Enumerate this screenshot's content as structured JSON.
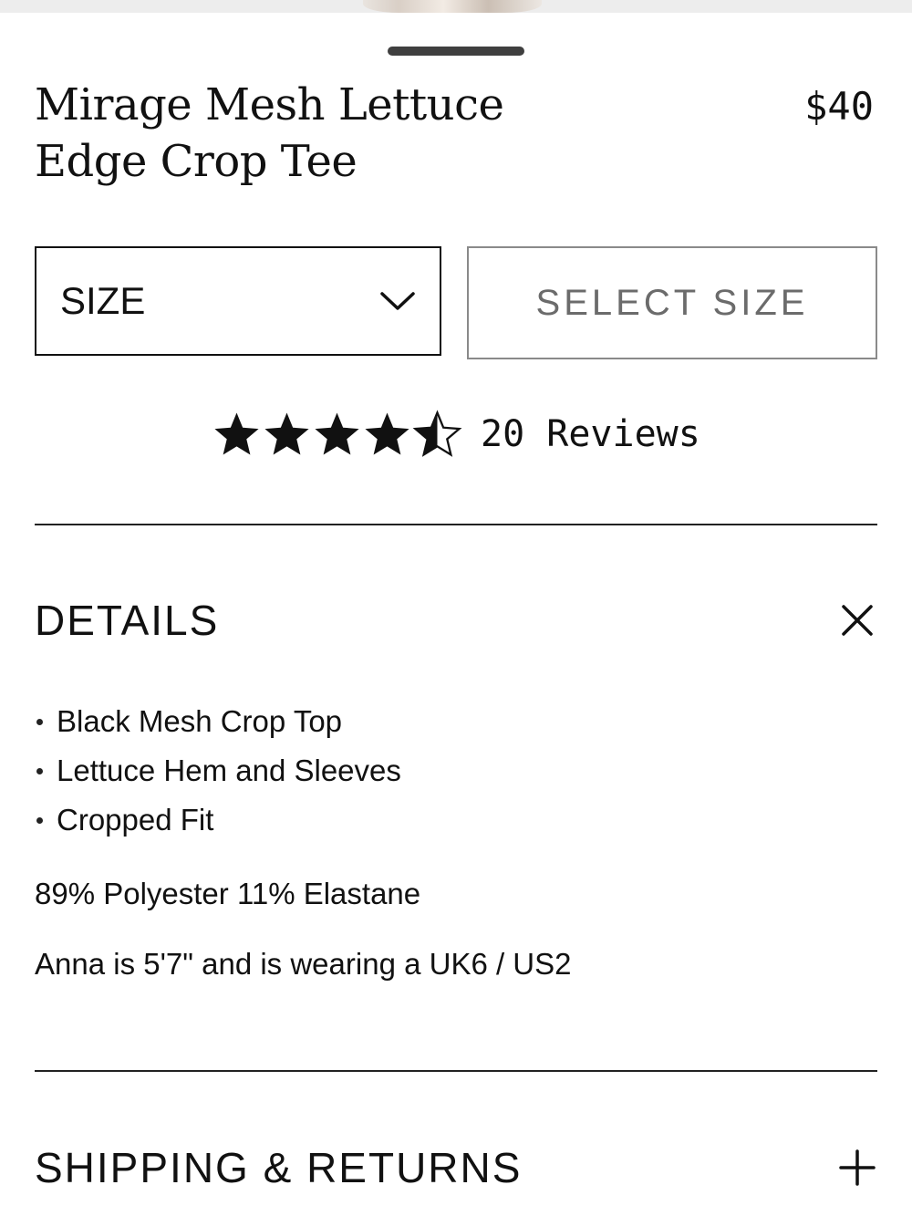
{
  "product": {
    "title": "Mirage Mesh Lettuce Edge Crop Tee",
    "price": "$40"
  },
  "size_select": {
    "label": "SIZE",
    "icon": "chevron-down-icon"
  },
  "add_button": {
    "label": "SELECT SIZE"
  },
  "rating": {
    "stars_value": 4.5,
    "stars_max": 5,
    "reviews_label": "20 Reviews"
  },
  "details": {
    "heading": "DETAILS",
    "toggle_icon": "close-icon",
    "bullets": [
      "Black Mesh Crop Top",
      "Lettuce Hem and Sleeves",
      "Cropped Fit"
    ],
    "composition": "89% Polyester 11% Elastane",
    "model_info": "Anna is 5'7\" and is wearing a UK6 / US2"
  },
  "shipping": {
    "heading": "SHIPPING & RETURNS",
    "toggle_icon": "plus-icon"
  },
  "colors": {
    "text": "#111111",
    "muted_button_text": "#6b6b6b",
    "muted_border": "#8a8a8a"
  }
}
